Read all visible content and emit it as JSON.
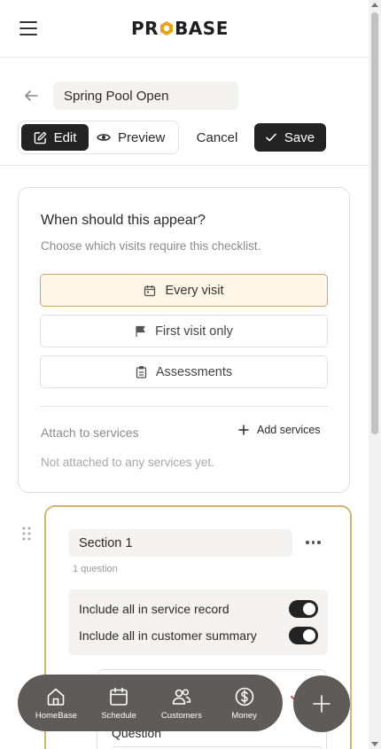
{
  "app": {
    "logo_text": "PROBASE",
    "logo_prefix": "PR",
    "logo_suffix": "BASE"
  },
  "header": {
    "menu_icon": "hamburger-menu-icon"
  },
  "title_row": {
    "back_icon": "arrow-left-icon",
    "checklist_name": "Spring Pool Open"
  },
  "toolbar": {
    "edit_label": "Edit",
    "preview_label": "Preview",
    "cancel_label": "Cancel",
    "save_label": "Save",
    "edit_icon": "pencil-square-icon",
    "preview_icon": "eye-icon",
    "save_icon": "check-icon"
  },
  "visibility": {
    "heading": "When should this appear?",
    "subtext": "Choose which visits require this checklist.",
    "options": [
      {
        "label": "Every visit",
        "icon": "calendar-icon",
        "selected": true
      },
      {
        "label": "First visit only",
        "icon": "flag-icon",
        "selected": false
      },
      {
        "label": "Assessments",
        "icon": "clipboard-icon",
        "selected": false
      }
    ],
    "attach_label": "Attach to services",
    "add_services_label": "Add services",
    "empty_text": "Not attached to any services yet."
  },
  "section": {
    "name": "Section 1",
    "question_count": "1 question",
    "toggles": [
      {
        "label": "Include all in service record",
        "on": true
      },
      {
        "label": "Include all in customer summary",
        "on": true
      }
    ],
    "question_label": "Question"
  },
  "bottom_nav": {
    "items": [
      {
        "label": "HomeBase",
        "icon": "home-icon"
      },
      {
        "label": "Schedule",
        "icon": "calendar-icon"
      },
      {
        "label": "Customers",
        "icon": "users-icon"
      },
      {
        "label": "Money",
        "icon": "dollar-circle-icon"
      }
    ],
    "fab_icon": "plus-icon"
  },
  "colors": {
    "dark": "#232323",
    "accent_gold": "#d2b474",
    "selected_bg": "#fdf6e6",
    "nav_bg": "#5e5b58",
    "logo_hex": "#e8a317"
  }
}
